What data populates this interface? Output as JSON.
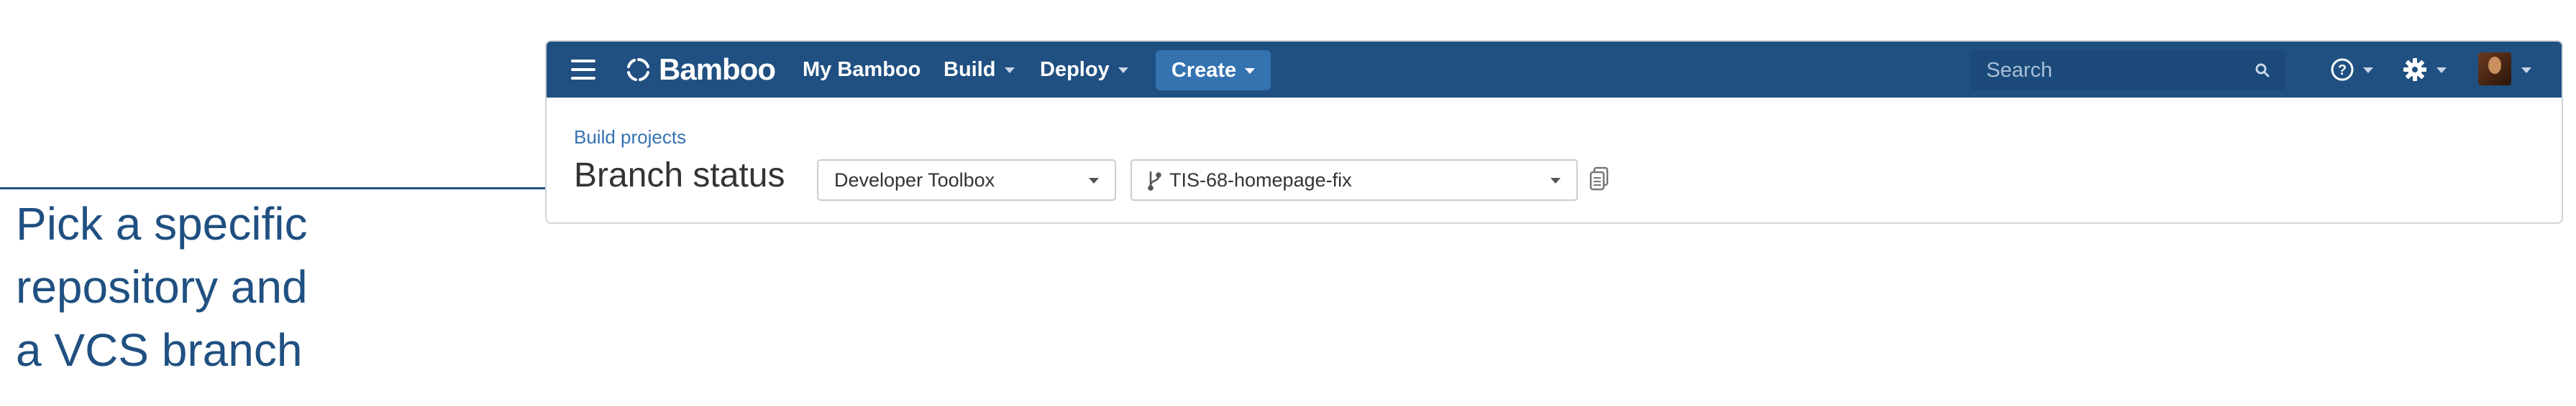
{
  "callout": {
    "lines": [
      "Pick a specific",
      "repository and",
      "a VCS branch"
    ]
  },
  "header": {
    "logo_text": "Bamboo",
    "nav": [
      {
        "label": "My Bamboo",
        "dropdown": false
      },
      {
        "label": "Build",
        "dropdown": true
      },
      {
        "label": "Deploy",
        "dropdown": true
      }
    ],
    "create_label": "Create",
    "search_placeholder": "Search",
    "icons": [
      "menu-icon",
      "bamboo-logo-icon",
      "search-icon",
      "help-icon",
      "gear-icon",
      "avatar"
    ]
  },
  "content": {
    "breadcrumb": "Build projects",
    "title": "Branch status",
    "repository_select": "Developer Toolbox",
    "branch_select": "TIS-68-homepage-fix"
  },
  "colors": {
    "header_bg": "#205081",
    "create_button": "#3572b0",
    "link": "#3572b0",
    "callout": "#205081"
  }
}
